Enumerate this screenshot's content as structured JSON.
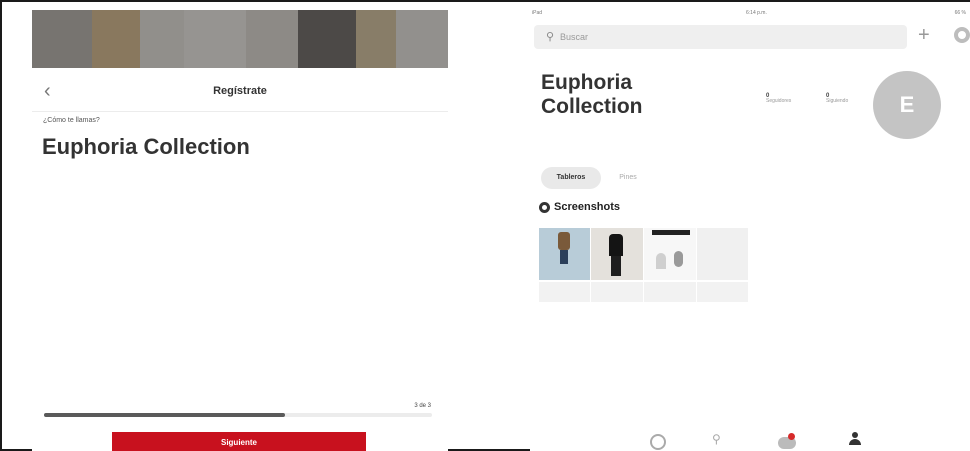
{
  "left_panel": {
    "header_title": "Regístrate",
    "back_icon": "chevron-left-icon",
    "question": "¿Cómo te llamas?",
    "name_value": "Euphoria Collection",
    "step": "3 de 3",
    "progress_fraction": 0.62,
    "next_button": "Siguiente",
    "accent_color": "#c8111e"
  },
  "right_panel": {
    "status_bar": {
      "left": "iPad",
      "center": "6:14 p.m.",
      "right": "66 %"
    },
    "search_placeholder": "Buscar",
    "profile_name": "Euphoria Collection",
    "followers": {
      "count": "0",
      "label": "Seguidores"
    },
    "following": {
      "count": "0",
      "label": "Siguiendo"
    },
    "avatar_letter": "E",
    "tabs": [
      {
        "label": "Tableros"
      },
      {
        "label": "Pines"
      }
    ],
    "board": {
      "title": "Screenshots"
    },
    "bottom_nav": [
      "home-icon",
      "search-icon",
      "notifications-icon",
      "profile-icon"
    ]
  }
}
